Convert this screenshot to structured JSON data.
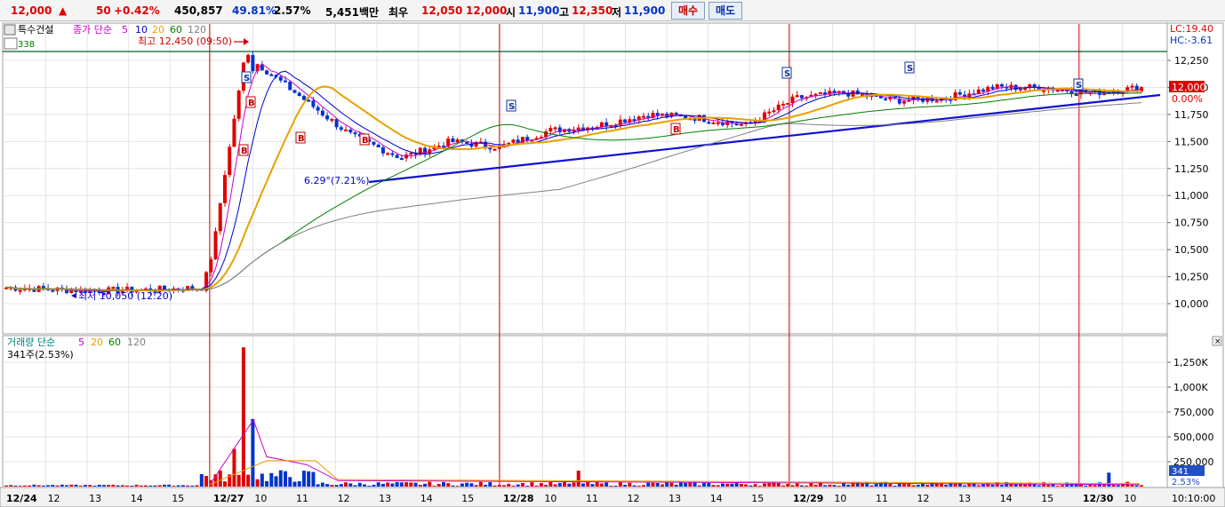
{
  "header": {
    "price": "12,000",
    "up_mark": "▲",
    "change": "50",
    "change_pct": "+0.42%",
    "volume": "450,857",
    "ratio": "49.81%",
    "turnover_pct": "2.57%",
    "amount": "5,451백만",
    "bid_label": "최우",
    "best_ask": "12,050",
    "best_bid": "12,000",
    "open_label": "시",
    "open": "11,900",
    "high_label": "고",
    "high": "12,350",
    "low_label": "저",
    "low": "11,900",
    "buy_button": "매수",
    "sell_button": "매도"
  },
  "price_panel": {
    "stock_name": "특수건설",
    "ma_legend": {
      "label": "종가 단순",
      "periods": [
        "5",
        "10",
        "20",
        "60",
        "120"
      ]
    },
    "indicator_value": "338",
    "high_note": "최고 12,450 (09:50)",
    "low_note": "최저 10,050 (12:20)",
    "trend_note": "6.29°(7.21%)",
    "lc": "LC:19.40",
    "hc": "HC:-3.61",
    "current_price": "12,000",
    "current_pct": "0.00%",
    "y_ticks": [
      "12,250",
      "12,000",
      "11,750",
      "11,500",
      "11,250",
      "11,000",
      "10,750",
      "10,500",
      "10,250",
      "10,000"
    ]
  },
  "volume_panel": {
    "legend_label": "거래량 단순",
    "ma_periods": [
      "5",
      "20",
      "60",
      "120"
    ],
    "current": "341주(2.53%)",
    "current_value": "341",
    "current_pct": "2.53%",
    "y_ticks": [
      "1,250K",
      "1,000K",
      "750,000",
      "500,000",
      "250,000"
    ]
  },
  "x_axis": {
    "labels": [
      "12/24",
      "12",
      "13",
      "14",
      "15",
      "12/27",
      "10",
      "11",
      "12",
      "13",
      "14",
      "15",
      "12/28",
      "10",
      "11",
      "12",
      "13",
      "14",
      "15",
      "12/29",
      "10",
      "11",
      "12",
      "13",
      "14",
      "15",
      "12/30",
      "10"
    ],
    "clock": "10:10:00"
  },
  "signal_markers": {
    "sell": [
      "S",
      "S",
      "S",
      "S",
      "S"
    ],
    "buy": [
      "B",
      "B",
      "B",
      "B",
      "B"
    ]
  },
  "colors": {
    "up": "#e00000",
    "down": "#0033cc",
    "ma5": "#cc00cc",
    "ma10": "#0000cc",
    "ma20": "#e8a000",
    "ma60": "#008000",
    "ma120": "#808080",
    "trendline": "#1010d0",
    "separator": "#cc0000",
    "resistance": "#006030"
  },
  "chart_data": {
    "type": "candlestick",
    "price_axis_range": [
      9850,
      12450
    ],
    "volume_axis_range": [
      0,
      1450000
    ],
    "sessions": [
      "12/24",
      "12/27",
      "12/28",
      "12/29",
      "12/30"
    ],
    "price_high": 12450,
    "price_low": 10050,
    "price_series_checkpoints": [
      10150,
      10130,
      10120,
      10130,
      10150,
      12250,
      11900,
      11550,
      11350,
      11500,
      11450,
      11600,
      11650,
      11750,
      11720,
      11650,
      11900,
      11950,
      11880,
      11900,
      12000,
      12000,
      11950,
      12000
    ],
    "volume_peaks": [
      1400000,
      680000,
      380000,
      160000,
      140000
    ]
  }
}
